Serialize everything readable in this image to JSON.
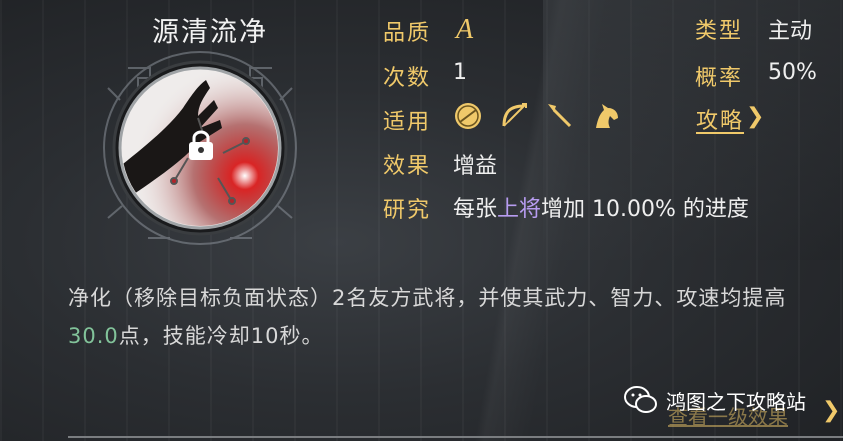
{
  "skill": {
    "name": "源清流净",
    "description_prefix": "净化（移除目标负面状态）2名友方武将，并使其武力、智力、攻速均提高",
    "description_value": "30.0",
    "description_suffix": "点，技能冷却10秒。"
  },
  "attributes": {
    "quality_label": "品质",
    "quality_value": "A",
    "type_label": "类型",
    "type_value": "主动",
    "count_label": "次数",
    "count_value": "1",
    "rate_label": "概率",
    "rate_value": "50%",
    "applies_label": "适用",
    "applies_icons": [
      "shield-icon",
      "bow-icon",
      "spear-icon",
      "horse-icon"
    ],
    "effect_label": "效果",
    "effect_value": "增益",
    "research_label": "研究",
    "research_prefix": "每张",
    "research_highlight": "上将",
    "research_suffix": "增加 10.00% 的进度"
  },
  "links": {
    "strategy": "攻略",
    "strategy_arrow": "❯",
    "view_more": "查看一级效果",
    "view_more_arrow": "❯"
  },
  "watermark": {
    "text": "鸿图之下攻略站"
  },
  "colors": {
    "gold": "#f0c96a",
    "purple": "#b79cf0",
    "green": "#82c39a"
  }
}
